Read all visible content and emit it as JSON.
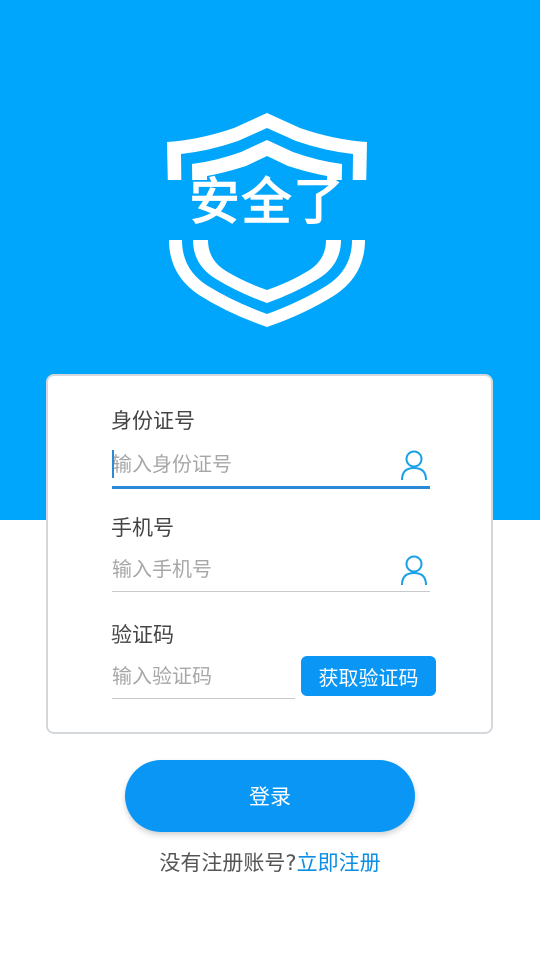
{
  "colors": {
    "brand": "#00a6fb",
    "accent": "#0a96f5",
    "link": "#0a8ee6",
    "active_underline": "#2b8ad8"
  },
  "logo": {
    "text": "安全了",
    "icon": "shield-icon"
  },
  "form": {
    "id_card": {
      "label": "身份证号",
      "placeholder": "输入身份证号",
      "icon": "user-icon"
    },
    "phone": {
      "label": "手机号",
      "placeholder": "输入手机号",
      "icon": "user-icon"
    },
    "code": {
      "label": "验证码",
      "placeholder": "输入验证码",
      "button": "获取验证码"
    }
  },
  "login": {
    "label": "登录"
  },
  "register": {
    "prompt": "没有注册账号?",
    "link": "立即注册"
  }
}
